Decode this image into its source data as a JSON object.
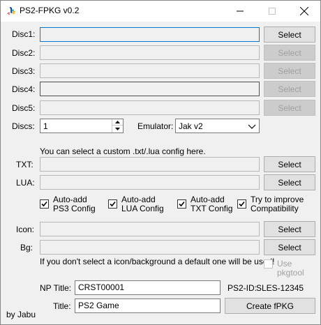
{
  "window": {
    "title": "PS2-FPKG v0.2",
    "icon": "playstation-logo-icon",
    "controls": [
      "minimize-icon",
      "maximize-icon",
      "close-icon"
    ]
  },
  "discs": [
    {
      "label": "Disc1:",
      "value": "",
      "button": "Select",
      "enabled": true
    },
    {
      "label": "Disc2:",
      "value": "",
      "button": "Select",
      "enabled": false
    },
    {
      "label": "Disc3:",
      "value": "",
      "button": "Select",
      "enabled": false
    },
    {
      "label": "Disc4:",
      "value": "",
      "button": "Select",
      "enabled": false
    },
    {
      "label": "Disc5:",
      "value": "",
      "button": "Select",
      "enabled": false
    }
  ],
  "discs_count": {
    "label": "Discs:",
    "value": "1"
  },
  "emulator": {
    "label": "Emulator:",
    "selected": "Jak v2"
  },
  "config_hint": "You can select a custom .txt/.lua config here.",
  "txt": {
    "label": "TXT:",
    "value": "",
    "button": "Select"
  },
  "lua": {
    "label": "LUA:",
    "value": "",
    "button": "Select"
  },
  "checkboxes": [
    {
      "line1": "Auto-add",
      "line2": "PS3 Config",
      "checked": true
    },
    {
      "line1": "Auto-add",
      "line2": "LUA Config",
      "checked": true
    },
    {
      "line1": "Auto-add",
      "line2": "TXT Config",
      "checked": true
    },
    {
      "line1": "Try to improve",
      "line2": "Compatibility",
      "checked": true
    }
  ],
  "icon_field": {
    "label": "Icon:",
    "value": "",
    "button": "Select"
  },
  "bg_field": {
    "label": "Bg:",
    "value": "",
    "button": "Select"
  },
  "default_hint": "If you don't select a icon/background a default one will be used!",
  "use_pkgtool": {
    "label": "Use pkgtool",
    "checked": false,
    "enabled": false
  },
  "np_title": {
    "label": "NP Title:",
    "value": "CRST00001"
  },
  "ps2_id": {
    "label": "PS2-ID:",
    "value": "SLES-12345"
  },
  "title_field": {
    "label": "Title:",
    "value": "PS2 Game"
  },
  "create_button": "Create fPKG",
  "author": "by Jabu"
}
